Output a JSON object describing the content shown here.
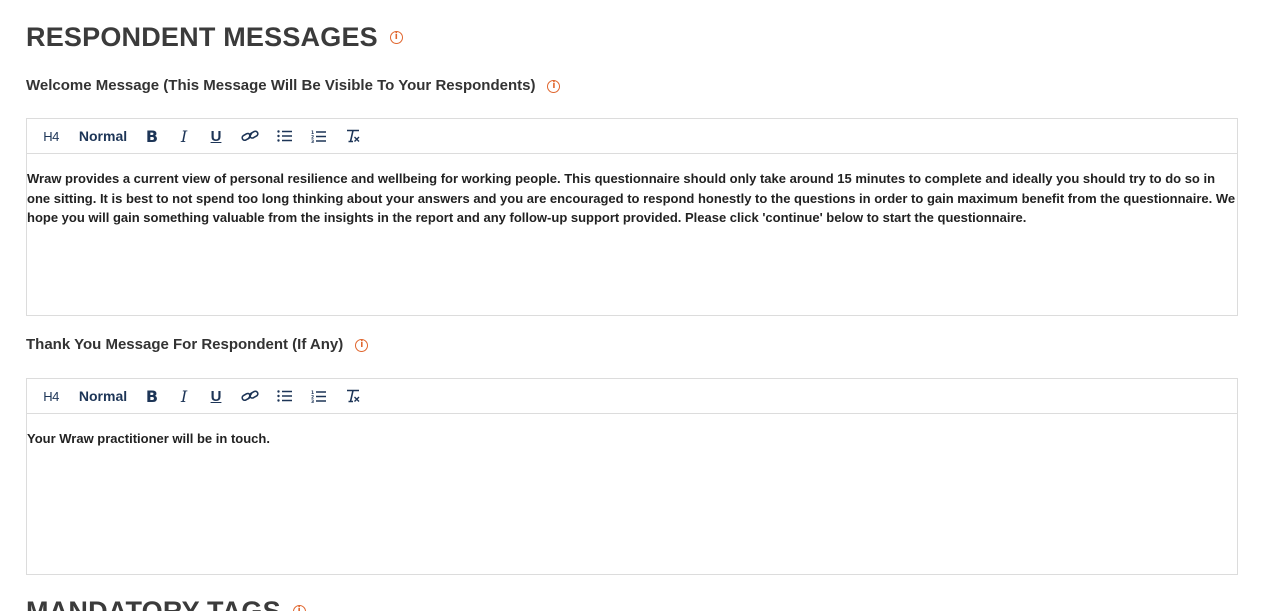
{
  "section_title": "RESPONDENT MESSAGES",
  "next_section_title": "MANDATORY TAGS",
  "info_glyph": "i",
  "toolbar": {
    "heading": "H4",
    "format": "Normal",
    "bold": "B",
    "italic": "I",
    "underline": "U",
    "icons": [
      "link-icon",
      "bullet-list-icon",
      "numbered-list-icon",
      "clear-format-icon"
    ]
  },
  "welcome": {
    "label": "Welcome Message (This Message Will Be Visible To Your Respondents)",
    "content": "Wraw provides a current view of personal resilience and wellbeing for working people. This questionnaire should only take around 15 minutes to complete and ideally you should try to do so in one sitting. It is best to not spend too long thinking about your answers and you are encouraged to respond honestly to the questions in order to gain maximum benefit from the questionnaire. We hope you will gain something valuable from the insights in the report and any follow-up support provided. Please click 'continue' below to start the questionnaire."
  },
  "thank_you": {
    "label": "Thank You Message For Respondent (If Any)",
    "content": "Your Wraw practitioner will be in touch."
  },
  "colors": {
    "accent": "#e0662e",
    "toolbar_icon": "#1d3557",
    "border": "#dcdcdc",
    "title": "#3b3b3b"
  }
}
